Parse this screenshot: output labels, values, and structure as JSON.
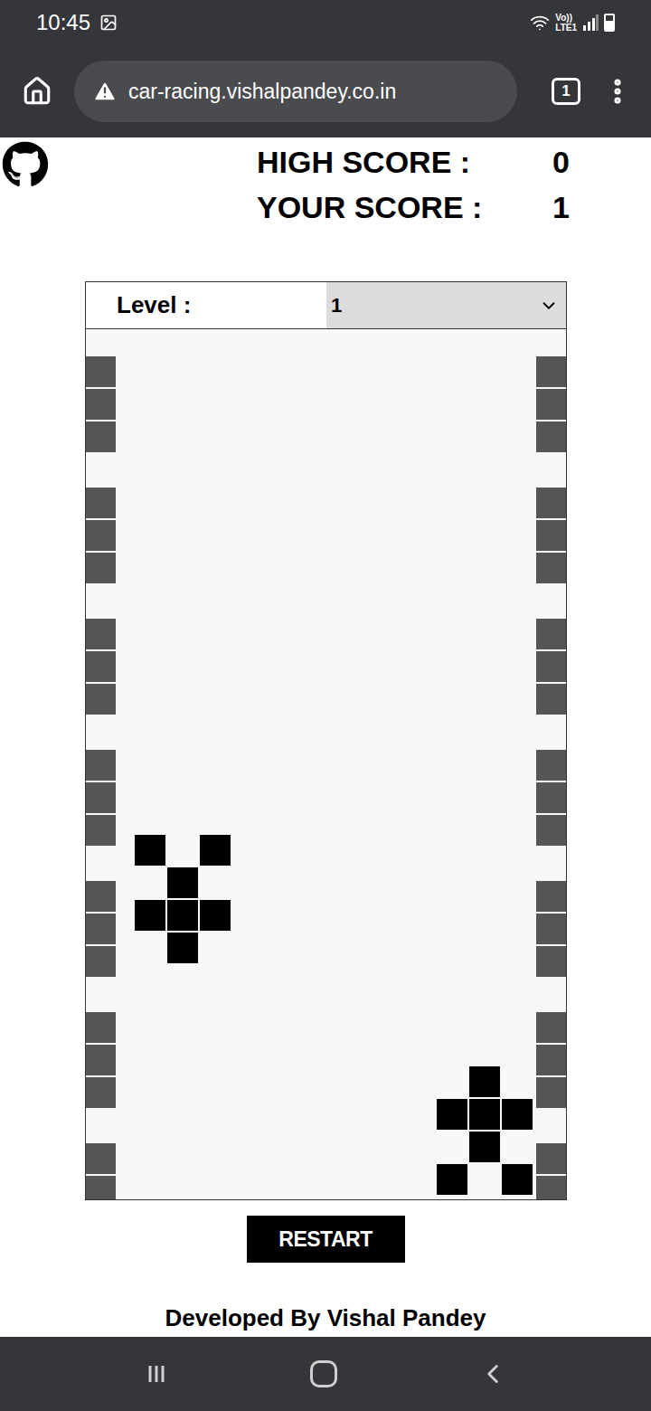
{
  "status_bar": {
    "time": "10:45",
    "network": "Vo))",
    "carrier": "LTE1"
  },
  "browser": {
    "url": "car-racing.vishalpandey.co.in",
    "tab_count": "1"
  },
  "scores": [
    {
      "label": "HIGH SCORE :",
      "value": "0"
    },
    {
      "label": "YOUR SCORE :",
      "value": "1"
    }
  ],
  "level": {
    "label": "Level :",
    "value": "1"
  },
  "cars": [
    {
      "kind": "enemy",
      "lane": 0
    },
    {
      "kind": "player",
      "lane": 2
    }
  ],
  "buttons": [
    "RESTART"
  ],
  "footer": "Developed By Vishal Pandey"
}
